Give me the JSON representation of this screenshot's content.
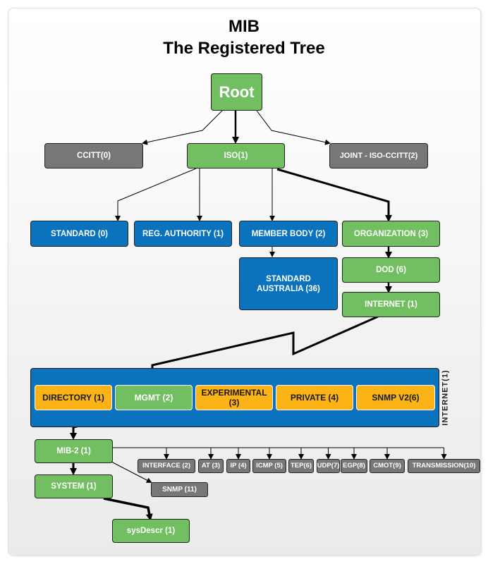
{
  "title": {
    "line1": "MIB",
    "line2": "The Registered Tree"
  },
  "colors": {
    "active_path": "#72bf62",
    "inactive": "#777777",
    "iso_branch": "#0b72be",
    "internet_child": "#fbb316"
  },
  "nodes": {
    "root": "Root",
    "ccitt": "CCITT(0)",
    "iso": "ISO(1)",
    "joint": "JOINT - ISO-CCITT(2)",
    "standard": "STANDARD (0)",
    "reg_authority": "REG. AUTHORITY (1)",
    "member_body": "MEMBER BODY (2)",
    "organization": "ORGANIZATION (3)",
    "standard_australia": "STANDARD AUSTRALIA (36)",
    "dod": "DOD (6)",
    "internet": "INTERNET (1)",
    "internet_group_label": "INTERNET(1)",
    "directory": "DIRECTORY (1)",
    "mgmt": "MGMT (2)",
    "experimental": "EXPERIMENTAL (3)",
    "private": "PRIVATE (4)",
    "snmpv2": "SNMP V2(6)",
    "mib2": "MIB-2 (1)",
    "system": "SYSTEM (1)",
    "sysdescr": "sysDescr (1)",
    "snmp": "SNMP (11)"
  },
  "mib2_children": [
    "INTERFACE (2)",
    "AT (3)",
    "IP (4)",
    "ICMP (5)",
    "TEP(6)",
    "UDP(7)",
    "EGP(8)",
    "CMOT(9)",
    "TRANSMISSION(10)"
  ]
}
